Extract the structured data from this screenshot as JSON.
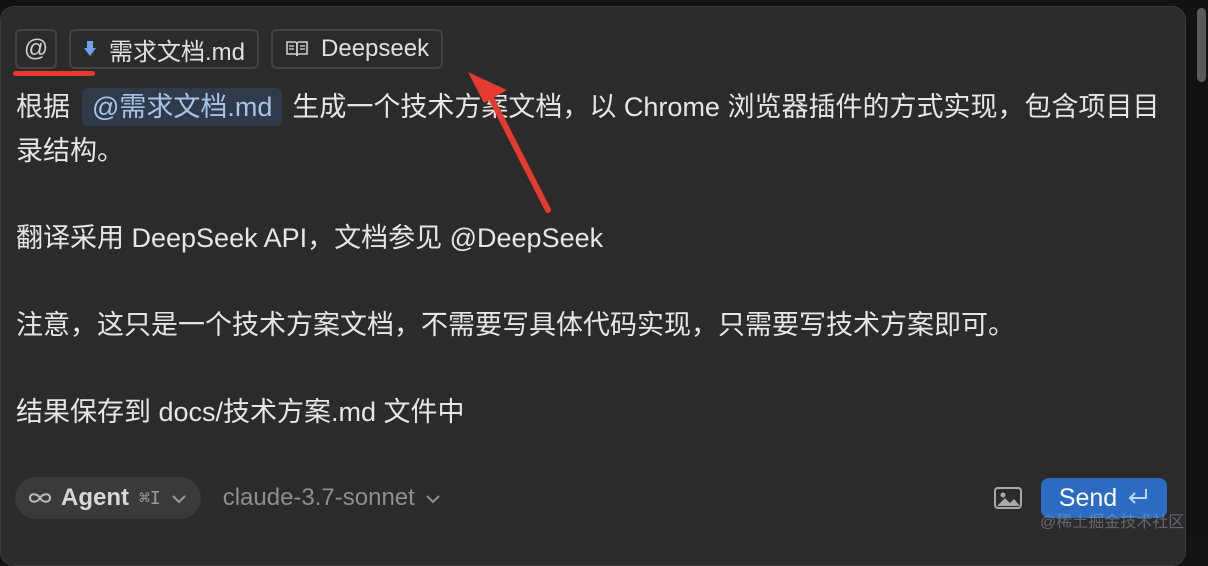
{
  "chips": {
    "at_symbol": "@",
    "file_chip": {
      "label": "需求文档.md",
      "icon": "download-arrow-icon"
    },
    "doc_chip": {
      "label": "Deepseek",
      "icon": "book-icon"
    }
  },
  "message": {
    "line1_pre": "根据",
    "mention": "@需求文档.md",
    "line1_post": "生成一个技术方案文档，以 Chrome 浏览器插件的方式实现，包含项目目录结构。",
    "para2": "翻译采用 DeepSeek API，文档参见 @DeepSeek",
    "para3": "注意，这只是一个技术方案文档，不需要写具体代码实现，只需要写技术方案即可。",
    "para4": "结果保存到 docs/技术方案.md 文件中"
  },
  "bottom_bar": {
    "agent_label": "Agent",
    "agent_shortcut": "⌘I",
    "agent_icon": "infinity-icon",
    "model": "claude-3.7-sonnet",
    "send_label": "Send",
    "send_icon": "return-icon",
    "image_icon": "image-icon"
  },
  "colors": {
    "annotation": "#e53a2f",
    "send_button": "#2b6cc2",
    "mention_bg": "#2f3a4a"
  },
  "watermark": "@稀土掘金技术社区"
}
